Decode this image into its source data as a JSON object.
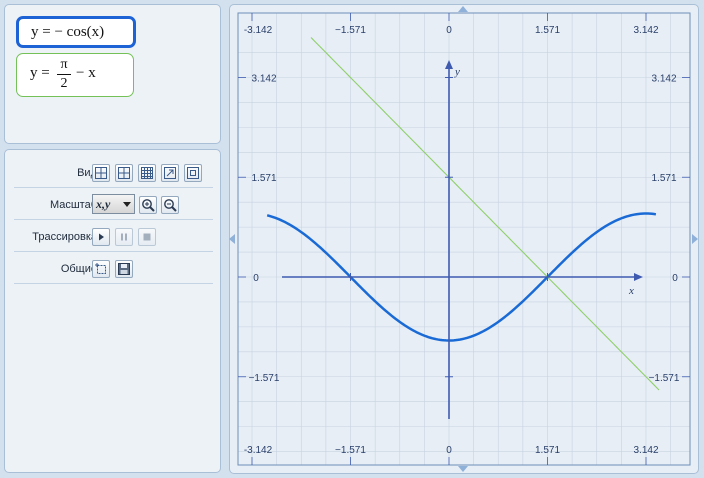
{
  "formulas": [
    {
      "lhs": "y = ",
      "rhs": "− cos(x)"
    },
    {
      "lhs": "y = ",
      "num": "π",
      "den": "2",
      "rest": "− x"
    }
  ],
  "controls": {
    "view_label": "Вид",
    "scale_label": "Масштаб",
    "scale_value": "x,y",
    "trace_label": "Трассировка",
    "general_label": "Общие"
  },
  "colors": {
    "curve_cos": "#1a6ad6",
    "line_linear": "#8fcf6a",
    "axis": "#3f5bb0",
    "grid": "#c7d3e0",
    "selected_border": "#1e63d6"
  },
  "chart_data": {
    "type": "line",
    "xlim": [
      -3.142,
      3.142
    ],
    "ylim": [
      -3.142,
      3.142
    ],
    "xticks": [
      -3.142,
      -1.571,
      0,
      1.571,
      3.142
    ],
    "yticks": [
      -3.142,
      -1.571,
      0,
      1.571,
      3.142
    ],
    "xtick_labels": [
      "-3.142",
      "−1.571",
      "0",
      "1.571",
      "3.142"
    ],
    "ytick_labels": [
      "3.142",
      "1.571",
      "0",
      "−1.571"
    ],
    "xlabel": "x",
    "ylabel": "y",
    "grid": true,
    "series": [
      {
        "function": "-cos(x)",
        "x_range": [
          -2.9,
          3.3
        ],
        "color": "#1a6ad6"
      },
      {
        "function": "pi/2 - x",
        "x_range": [
          -2.2,
          3.35
        ],
        "color": "#8fcf6a"
      }
    ]
  }
}
